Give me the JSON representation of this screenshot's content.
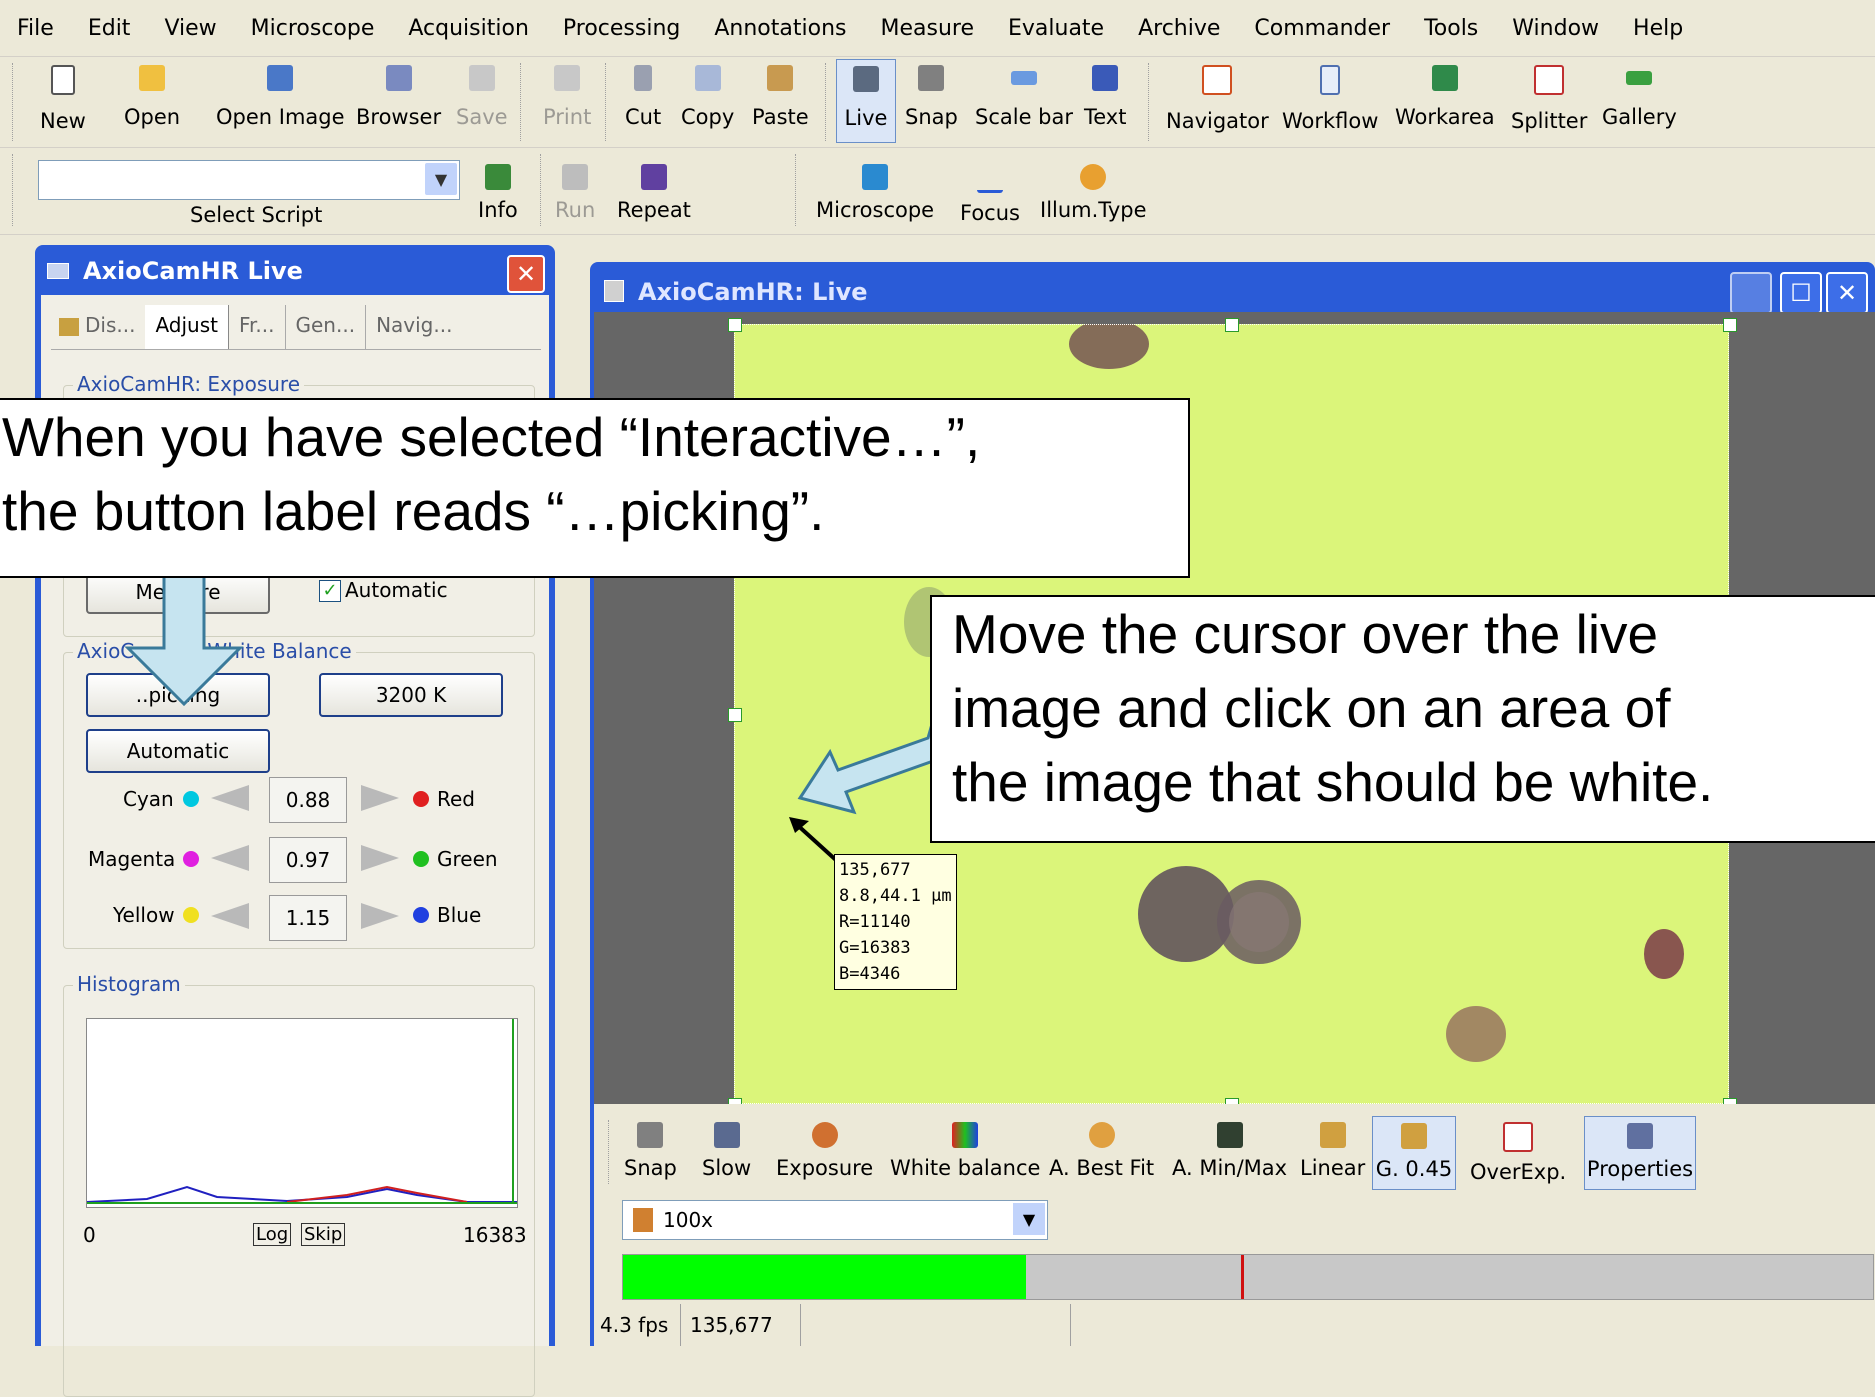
{
  "menu": [
    "File",
    "Edit",
    "View",
    "Microscope",
    "Acquisition",
    "Processing",
    "Annotations",
    "Measure",
    "Evaluate",
    "Archive",
    "Commander",
    "Tools",
    "Window",
    "Help"
  ],
  "toolbar": {
    "new": "New",
    "open": "Open",
    "open_image": "Open Image",
    "browser": "Browser",
    "save": "Save",
    "print": "Print",
    "cut": "Cut",
    "copy": "Copy",
    "paste": "Paste",
    "live": "Live",
    "snap": "Snap",
    "scale_bar": "Scale bar",
    "text": "Text",
    "navigator": "Navigator",
    "workflow": "Workflow",
    "workarea": "Workarea",
    "splitter": "Splitter",
    "gallery": "Gallery"
  },
  "toolbar2": {
    "select_script": "Select Script",
    "info": "Info",
    "run": "Run",
    "repeat": "Repeat",
    "microscope": "Microscope",
    "focus": "Focus",
    "illum_type": "Illum.Type"
  },
  "left_panel": {
    "title": "AxioCamHR Live",
    "tabs": [
      "Dis...",
      "Adjust",
      "Fr...",
      "Gen...",
      "Navig..."
    ],
    "exposure_group": "AxioCamHR: Exposure",
    "measure_btn": "Measure",
    "automatic_label": "Automatic",
    "wb_group": "AxioCamHR: White Balance",
    "picking_btn": "..picking",
    "kelvin_btn": "3200 K",
    "automatic_btn": "Automatic",
    "cyan": "Cyan",
    "red": "Red",
    "cyan_val": "0.88",
    "magenta": "Magenta",
    "green": "Green",
    "magenta_val": "0.97",
    "yellow": "Yellow",
    "blue": "Blue",
    "yellow_val": "1.15",
    "histogram_group": "Histogram",
    "hist_min": "0",
    "hist_max": "16383",
    "log": "Log",
    "skip": "Skip"
  },
  "main_window": {
    "title": "AxioCamHR: Live",
    "tooltip": [
      "135,677",
      "8.8,44.1 µm",
      "R=11140",
      "G=16383",
      "B=4346"
    ],
    "bottom_toolbar": [
      "Snap",
      "Slow",
      "Exposure",
      "White balance",
      "A. Best Fit",
      "A. Min/Max",
      "Linear",
      "G. 0.45",
      "OverExp.",
      "Properties"
    ],
    "objective": "100x",
    "status_fps": "4.3 fps",
    "status_coords": "135,677"
  },
  "callouts": {
    "top": [
      "When you have selected “Interactive…”,",
      "the button label reads “…picking”."
    ],
    "right": [
      "Move the cursor over the live",
      "image and click on an area of",
      "the image that should be white."
    ]
  },
  "colors": {
    "title_bar": "#2a5bd7",
    "live_image": "#dbf57a",
    "close_red": "#e0533a"
  }
}
